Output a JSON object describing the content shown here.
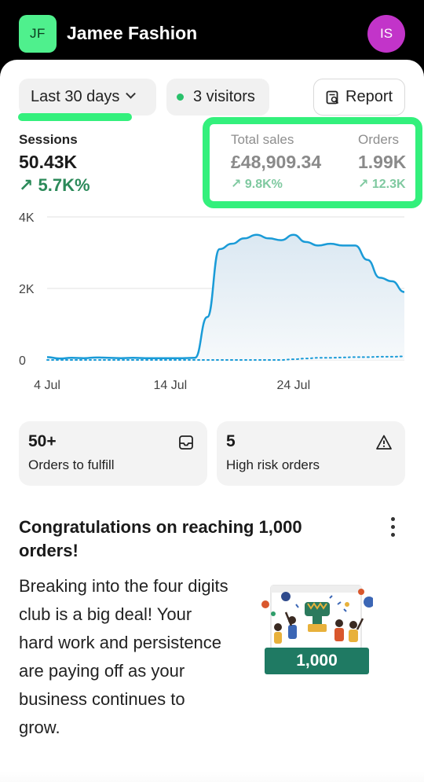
{
  "header": {
    "store_initials": "JF",
    "store_name": "Jamee Fashion",
    "user_initials": "IS"
  },
  "filters": {
    "date_range": "Last 30 days",
    "visitors": "3 visitors",
    "report_label": "Report"
  },
  "metrics": {
    "sessions": {
      "label": "Sessions",
      "value": "50.43K",
      "change": "↗ 5.7K%"
    },
    "total_sales": {
      "label": "Total sales",
      "value": "£48,909.34",
      "change": "↗ 9.8K%"
    },
    "orders": {
      "label": "Orders",
      "value": "1.99K",
      "change": "↗ 12.3K"
    }
  },
  "chart_data": {
    "type": "line",
    "y_ticks": [
      "4K",
      "2K",
      "0"
    ],
    "ylim": [
      0,
      4000
    ],
    "x_ticks": [
      "4 Jul",
      "14 Jul",
      "24 Jul"
    ],
    "x": [
      "4 Jul",
      "5 Jul",
      "6 Jul",
      "7 Jul",
      "8 Jul",
      "9 Jul",
      "10 Jul",
      "11 Jul",
      "12 Jul",
      "13 Jul",
      "14 Jul",
      "15 Jul",
      "16 Jul",
      "17 Jul",
      "18 Jul",
      "19 Jul",
      "20 Jul",
      "21 Jul",
      "22 Jul",
      "23 Jul",
      "24 Jul",
      "25 Jul",
      "26 Jul",
      "27 Jul",
      "28 Jul",
      "29 Jul",
      "30 Jul",
      "31 Jul",
      "1 Aug",
      "2 Aug"
    ],
    "series": [
      {
        "values": [
          80,
          40,
          60,
          50,
          70,
          60,
          50,
          60,
          50,
          50,
          50,
          50,
          60,
          1200,
          3100,
          3250,
          3400,
          3500,
          3400,
          3350,
          3500,
          3300,
          3200,
          3250,
          3200,
          3200,
          2800,
          2300,
          2200,
          1900
        ]
      },
      {
        "values": [
          0,
          0,
          0,
          0,
          0,
          0,
          0,
          0,
          0,
          0,
          0,
          0,
          0,
          0,
          0,
          0,
          0,
          0,
          0,
          0,
          20,
          40,
          60,
          60,
          70,
          80,
          80,
          90,
          90,
          100
        ]
      }
    ],
    "colors": {
      "line": "#1a9bd7",
      "fill": "#e9f2f8"
    },
    "grid": true
  },
  "cards": {
    "fulfill": {
      "count": "50+",
      "label": "Orders to fulfill"
    },
    "risk": {
      "count": "5",
      "label": "High risk orders"
    }
  },
  "congrats": {
    "title": "Congratulations on reaching 1,000 orders!",
    "body": "Breaking into the four digits club is a big deal! Your hard work and persistence are paying off as your business continues to grow.",
    "badge": "1,000"
  }
}
